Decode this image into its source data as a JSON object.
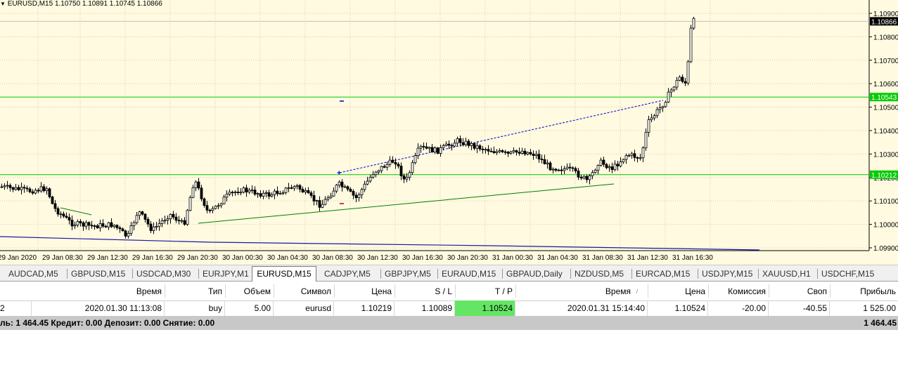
{
  "chart": {
    "header_text": "EURUSD,M15  1.10750 1.10891 1.10745 1.10866",
    "price_labels": [
      "1.10900",
      "1.10800",
      "1.10700",
      "1.10600",
      "1.10500",
      "1.10400",
      "1.10300",
      "1.10200",
      "1.10100",
      "1.10000",
      "1.09900"
    ],
    "current_price_tag": "1.10866",
    "tp_line_tag": "1.10543",
    "open_line_tag": "1.10212",
    "time_labels": [
      "29 Jan 2020",
      "29 Jan 08:30",
      "29 Jan 12:30",
      "29 Jan 16:30",
      "29 Jan 20:30",
      "30 Jan 00:30",
      "30 Jan 04:30",
      "30 Jan 08:30",
      "30 Jan 12:30",
      "30 Jan 16:30",
      "30 Jan 20:30",
      "31 Jan 00:30",
      "31 Jan 04:30",
      "31 Jan 08:30",
      "31 Jan 12:30",
      "31 Jan 16:30"
    ],
    "colors": {
      "background": "#fffae0",
      "grid": "#d6d0b0",
      "candle": "#000000",
      "level_line": "#00c800",
      "trendline_blue": "#0000c8",
      "trendline_green": "#008000",
      "price_tag_green": "#00cc00"
    }
  },
  "tabs": [
    {
      "label": "AUDCAD,M5"
    },
    {
      "label": "GBPUSD,M15"
    },
    {
      "label": "USDCAD,M30"
    },
    {
      "label": "EURJPY,M1"
    },
    {
      "label": "EURUSD,M15"
    },
    {
      "label": "CADJPY,M5"
    },
    {
      "label": "GBPJPY,M5"
    },
    {
      "label": "EURAUD,M15"
    },
    {
      "label": "GBPAUD,Daily"
    },
    {
      "label": "NZDUSD,M5"
    },
    {
      "label": "EURCAD,M15"
    },
    {
      "label": "USDJPY,M15"
    },
    {
      "label": "XAUUSD,H1"
    },
    {
      "label": "USDCHF,M15"
    }
  ],
  "active_tab": "EURUSD,M15",
  "terminal": {
    "headers": {
      "time_open": "Время",
      "type": "Тип",
      "volume": "Объем",
      "symbol": "Символ",
      "price_open": "Цена",
      "sl": "S / L",
      "tp": "T / P",
      "time_close": "Время",
      "sort_mark": "/",
      "price_close": "Цена",
      "commission": "Комиссия",
      "swap": "Своп",
      "profit": "Прибыль"
    },
    "row": {
      "ticket_tail": "2",
      "time_open": "2020.01.30 11:13:08",
      "type": "buy",
      "volume": "5.00",
      "symbol": "eurusd",
      "price_open": "1.10219",
      "sl": "1.10089",
      "tp": "1.10524",
      "time_close": "2020.01.31 15:14:40",
      "price_close": "1.10524",
      "commission": "-20.00",
      "swap": "-40.55",
      "profit": "1 525.00"
    },
    "summary": {
      "text": "ль: 1 464.45  Кредит: 0.00  Депозит: 0.00  Снятие: 0.00",
      "total": "1 464.45"
    }
  }
}
